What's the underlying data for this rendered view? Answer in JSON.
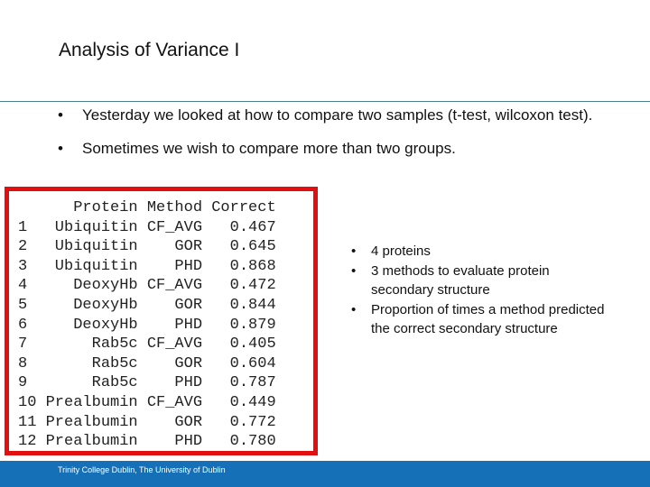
{
  "slide": {
    "title": "Analysis of Variance I",
    "bullets": [
      "Yesterday we looked at how to compare two samples (t-test, wilcoxon test).",
      "Sometimes we wish to compare more than two groups."
    ]
  },
  "table": {
    "columns": [
      "Protein",
      "Method",
      "Correct"
    ],
    "rows": [
      [
        "1",
        "Ubiquitin",
        "CF_AVG",
        "0.467"
      ],
      [
        "2",
        "Ubiquitin",
        "GOR",
        "0.645"
      ],
      [
        "3",
        "Ubiquitin",
        "PHD",
        "0.868"
      ],
      [
        "4",
        "DeoxyHb",
        "CF_AVG",
        "0.472"
      ],
      [
        "5",
        "DeoxyHb",
        "GOR",
        "0.844"
      ],
      [
        "6",
        "DeoxyHb",
        "PHD",
        "0.879"
      ],
      [
        "7",
        "Rab5c",
        "CF_AVG",
        "0.405"
      ],
      [
        "8",
        "Rab5c",
        "GOR",
        "0.604"
      ],
      [
        "9",
        "Rab5c",
        "PHD",
        "0.787"
      ],
      [
        "10",
        "Prealbumin",
        "CF_AVG",
        "0.449"
      ],
      [
        "11",
        "Prealbumin",
        "GOR",
        "0.772"
      ],
      [
        "12",
        "Prealbumin",
        "PHD",
        "0.780"
      ]
    ],
    "highlight_color": "#e10f0f"
  },
  "side_notes": [
    "4 proteins",
    "3 methods  to evaluate protein secondary structure",
    "Proportion of times a method predicted the correct secondary structure"
  ],
  "footer": {
    "text": "Trinity College Dublin, The University of Dublin",
    "color": "#1570b8"
  },
  "bullet_glyph": "•"
}
